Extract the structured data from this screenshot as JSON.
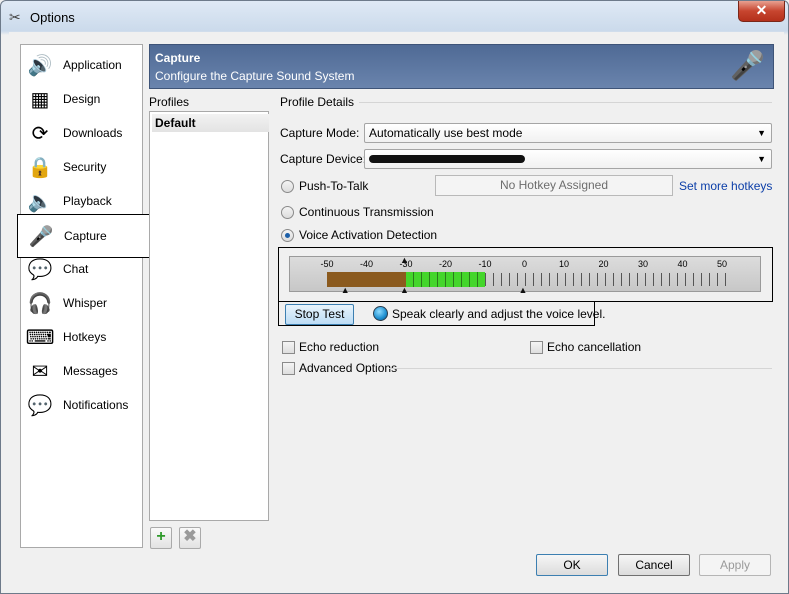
{
  "window": {
    "title": "Options",
    "close": "✕"
  },
  "sidebar": {
    "items": [
      {
        "label": "Application",
        "icon": "application-icon",
        "glyph": "🔊"
      },
      {
        "label": "Design",
        "icon": "design-icon",
        "glyph": "▦"
      },
      {
        "label": "Downloads",
        "icon": "downloads-icon",
        "glyph": "⟳"
      },
      {
        "label": "Security",
        "icon": "security-icon",
        "glyph": "🔒"
      },
      {
        "label": "Playback",
        "icon": "playback-icon",
        "glyph": "🔈"
      },
      {
        "label": "Capture",
        "icon": "microphone-icon",
        "glyph": "🎤",
        "selected": true
      },
      {
        "label": "Chat",
        "icon": "chat-icon",
        "glyph": "💬"
      },
      {
        "label": "Whisper",
        "icon": "headset-icon",
        "glyph": "🎧"
      },
      {
        "label": "Hotkeys",
        "icon": "hotkeys-icon",
        "glyph": "⌨"
      },
      {
        "label": "Messages",
        "icon": "messages-icon",
        "glyph": "✉"
      },
      {
        "label": "Notifications",
        "icon": "notifications-icon",
        "glyph": "💬"
      }
    ]
  },
  "header": {
    "title": "Capture",
    "subtitle": "Configure the Capture Sound System",
    "icon": "microphone-icon"
  },
  "profiles": {
    "label": "Profiles",
    "items": [
      "Default"
    ],
    "add_glyph": "+",
    "remove_glyph": "✖"
  },
  "details": {
    "label": "Profile Details",
    "capture_mode_label": "Capture Mode:",
    "capture_mode_value": "Automatically use best mode",
    "capture_device_label": "Capture Device:",
    "push_to_talk": "Push-To-Talk",
    "hotkey_placeholder": "No Hotkey Assigned",
    "set_hotkeys_link": "Set more hotkeys",
    "continuous": "Continuous Transmission",
    "voice_activation": "Voice Activation Detection",
    "selected_mode": "Voice Activation Detection",
    "meter": {
      "scale": [
        "-50",
        "-40",
        "-30",
        "-20",
        "-10",
        "0",
        "10",
        "20",
        "30",
        "40",
        "50"
      ],
      "level_from": -50,
      "level_to": -10,
      "threshold": -30,
      "colors": {
        "low": "#8b5a1e",
        "high": "#44d62b"
      }
    },
    "stop_test": "Stop Test",
    "test_hint": "Speak clearly and adjust the voice level.",
    "echo_reduction": "Echo reduction",
    "echo_cancellation": "Echo cancellation",
    "advanced": "Advanced Options"
  },
  "buttons": {
    "ok": "OK",
    "cancel": "Cancel",
    "apply": "Apply"
  }
}
